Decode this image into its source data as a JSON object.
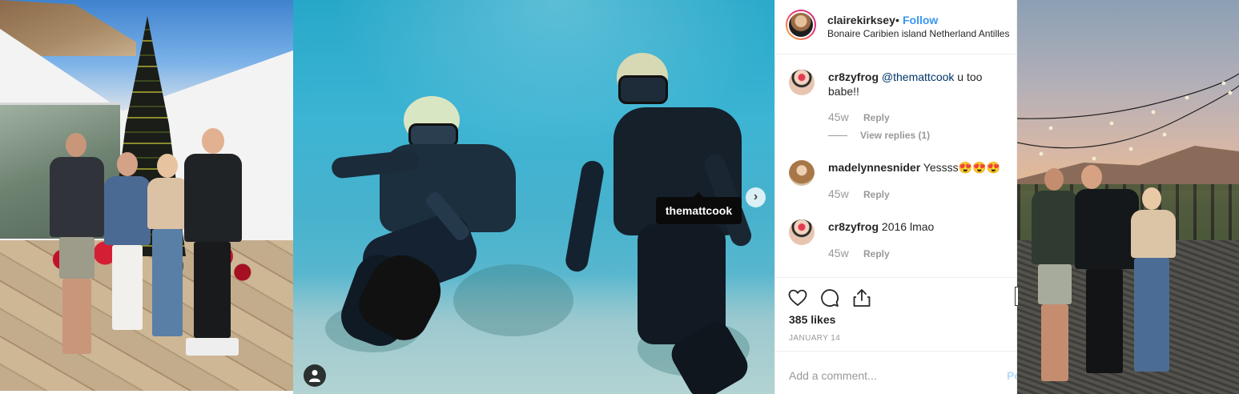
{
  "post": {
    "header": {
      "username": "clairekirksey",
      "separator": "•",
      "follow_label": "Follow",
      "location": "Bonaire Caribien island Netherland Antilles"
    },
    "photo_tag": "themattcook",
    "comments": [
      {
        "username": "cr8zyfrog",
        "mention": "@themattcook",
        "text": "u too babe!!",
        "age": "45w",
        "reply_label": "Reply",
        "view_replies": "View replies (1)"
      },
      {
        "username": "madelynnesnider",
        "text": "Yessss😍😍😍",
        "age": "45w",
        "reply_label": "Reply"
      },
      {
        "username": "cr8zyfrog",
        "text": "2016 lmao",
        "age": "45w",
        "reply_label": "Reply"
      }
    ],
    "likes": "385 likes",
    "date": "JANUARY 14",
    "add_comment_placeholder": "Add a comment...",
    "post_label": "Post"
  },
  "icons": {
    "next": "chevron-right-icon",
    "user_tag": "user-tag-icon",
    "like": "heart-icon",
    "comment": "comment-bubble-icon",
    "share": "share-icon"
  },
  "colors": {
    "link_blue": "#3897f0",
    "mention_blue": "#003569",
    "text_primary": "#262626",
    "text_muted": "#999999"
  }
}
